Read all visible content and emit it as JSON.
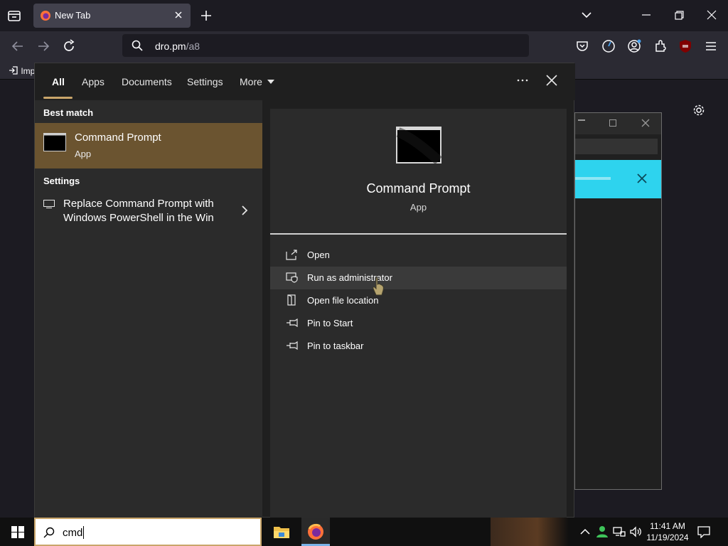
{
  "browser": {
    "tab": {
      "title": "New Tab"
    },
    "url": {
      "host": "dro.pm",
      "path": "/a8"
    },
    "bookmark": {
      "label": "Imp"
    }
  },
  "start_menu": {
    "tabs": [
      {
        "label": "All",
        "active": true
      },
      {
        "label": "Apps"
      },
      {
        "label": "Documents"
      },
      {
        "label": "Settings"
      },
      {
        "label": "More"
      }
    ],
    "best_match": {
      "section_title": "Best match",
      "name": "Command Prompt",
      "type": "App"
    },
    "settings": {
      "section_title": "Settings",
      "item": "Replace Command Prompt with Windows PowerShell in the Win"
    },
    "preview": {
      "name": "Command Prompt",
      "type": "App"
    },
    "actions": [
      {
        "label": "Open",
        "icon": "open-icon"
      },
      {
        "label": "Run as administrator",
        "icon": "shield-icon"
      },
      {
        "label": "Open file location",
        "icon": "folder-location-icon"
      },
      {
        "label": "Pin to Start",
        "icon": "pin-icon"
      },
      {
        "label": "Pin to taskbar",
        "icon": "pin-icon"
      }
    ]
  },
  "taskbar": {
    "search_value": "cmd",
    "clock": {
      "time": "11:41 AM",
      "date": "11/19/2024"
    }
  },
  "colors": {
    "accent": "#c9a56a",
    "best_match_bg": "#6b5430",
    "cyan_panel": "#2ed3ee"
  }
}
